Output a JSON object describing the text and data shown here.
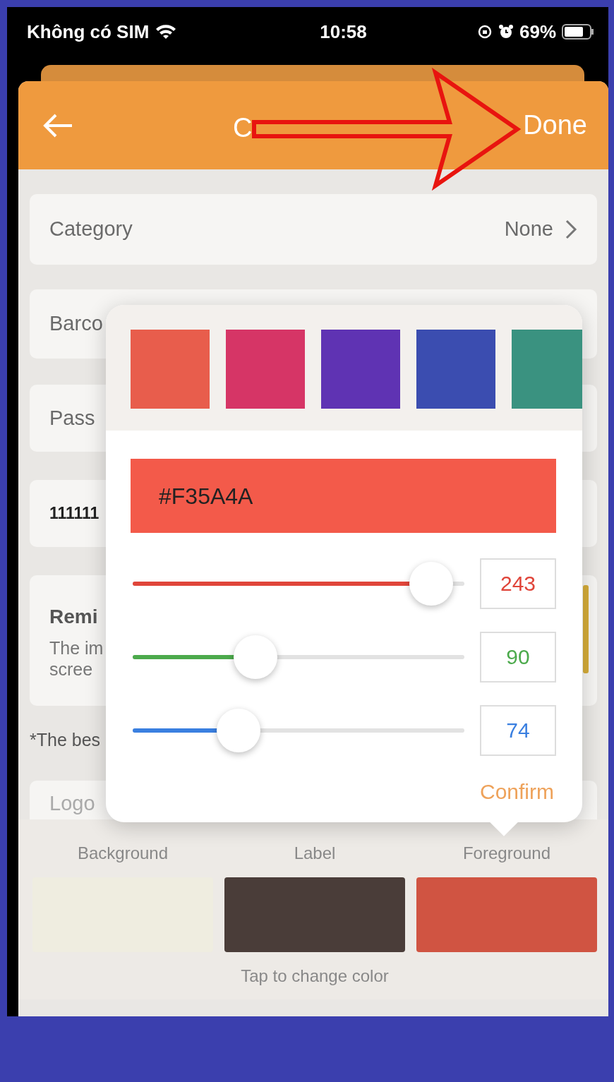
{
  "status_bar": {
    "carrier": "Không có SIM",
    "time": "10:58",
    "battery": "69%"
  },
  "header": {
    "title": "C",
    "action": "Done"
  },
  "rows": [
    {
      "kind": "nav",
      "label": "Category",
      "value": "None"
    },
    {
      "kind": "label",
      "label": "Barco"
    },
    {
      "kind": "label",
      "label": "Pass"
    },
    {
      "kind": "value",
      "label": "111111"
    },
    {
      "kind": "reminder",
      "label": "Remi",
      "lines": [
        "The im",
        "scree"
      ]
    }
  ],
  "note": "*The bes",
  "logo_label": "Logo",
  "colors": {
    "items": [
      {
        "label": "Background",
        "color": "#efede0"
      },
      {
        "label": "Label",
        "color": "#4a3d39"
      },
      {
        "label": "Foreground",
        "color": "#d05442"
      }
    ],
    "hint": "Tap to change color"
  },
  "picker": {
    "palette": [
      {
        "color": "#e85d4c"
      },
      {
        "color": "#d63566"
      },
      {
        "color": "#5f33b3"
      },
      {
        "color": "#3b4db0"
      },
      {
        "color": "#3a9280"
      }
    ],
    "hex": "#F35A4A",
    "channels": [
      {
        "level": 0.9,
        "value": "243",
        "color": "#e0453a"
      },
      {
        "level": 0.37,
        "value": "90",
        "color": "#4caa4c"
      },
      {
        "level": 0.32,
        "value": "74",
        "color": "#3a7fe0"
      }
    ],
    "confirm": "Confirm"
  }
}
